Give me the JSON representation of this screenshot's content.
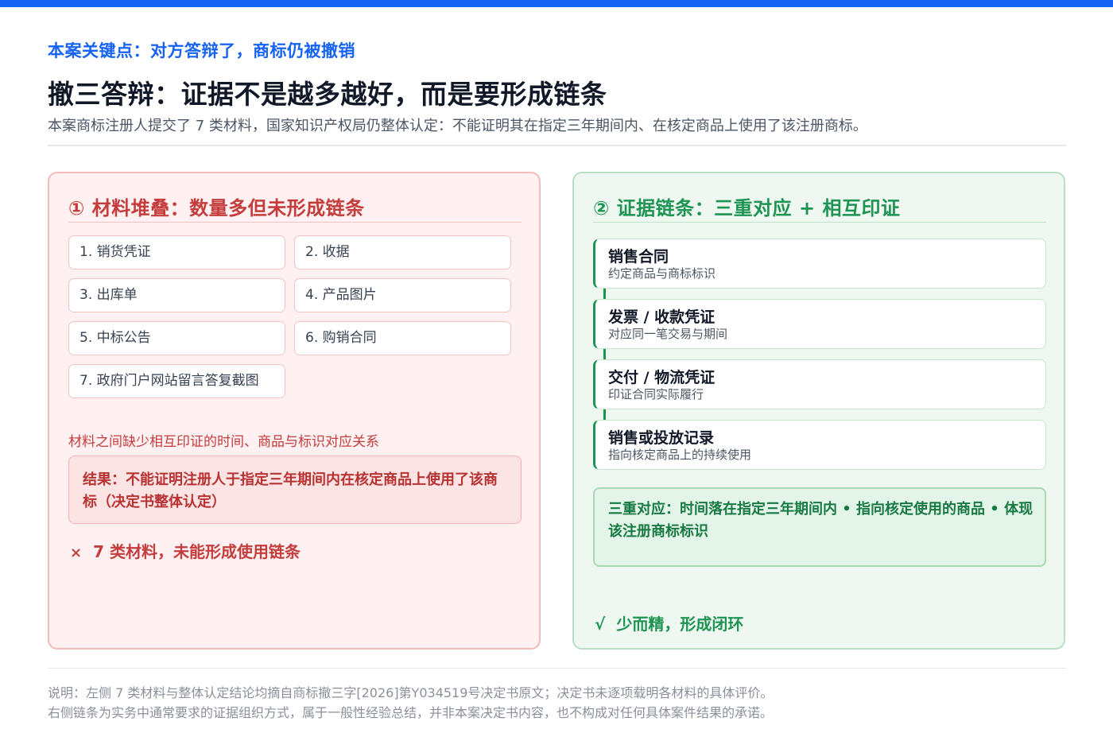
{
  "header": {
    "kicker": "本案关键点：对方答辩了，商标仍被撤销",
    "headline": "撤三答辩：证据不是越多越好，而是要形成链条",
    "subtitle": "本案商标注册人提交了 7 类材料，国家知识产权局仍整体认定：不能证明其在指定三年期间内、在核定商品上使用了该注册商标。"
  },
  "left": {
    "title": "① 材料堆叠：数量多但未形成链条",
    "materials": [
      "1. 销货凭证",
      "2. 收据",
      "3. 出库单",
      "4. 产品图片",
      "5. 中标公告",
      "6. 购销合同",
      "7. 政府门户网站留言答复截图"
    ],
    "gap_note": "材料之间缺少相互印证的时间、商品与标识对应关系",
    "result": "结果：不能证明注册人于指定三年期间内在核定商品上使用了该商标（决定书整体认定）",
    "verdict_mark": "×",
    "verdict": "7 类材料，未能形成使用链条"
  },
  "right": {
    "title": "② 证据链条：三重对应 + 相互印证",
    "chain": [
      {
        "title": "销售合同",
        "desc": "约定商品与商标标识"
      },
      {
        "title": "发票 / 收款凭证",
        "desc": "对应同一笔交易与期间"
      },
      {
        "title": "交付 / 物流凭证",
        "desc": "印证合同实际履行"
      },
      {
        "title": "销售或投放记录",
        "desc": "指向核定商品上的持续使用"
      }
    ],
    "triple": "三重对应：时间落在指定三年期间内 • 指向核定使用的商品 • 体现该注册商标标识",
    "verdict_mark": "√",
    "verdict": "少而精，形成闭环"
  },
  "footer": {
    "line1": "说明：左侧 7 类材料与整体认定结论均摘自商标撤三字[2026]第Y034519号决定书原文；决定书未逐项载明各材料的具体评价。",
    "line2": "右侧链条为实务中通常要求的证据组织方式，属于一般性经验总结，并非本案决定书内容，也不构成对任何具体案件结果的承诺。"
  },
  "colors": {
    "accent": "#1663f4",
    "negative": "#c43c3c",
    "positive": "#1e9452"
  }
}
